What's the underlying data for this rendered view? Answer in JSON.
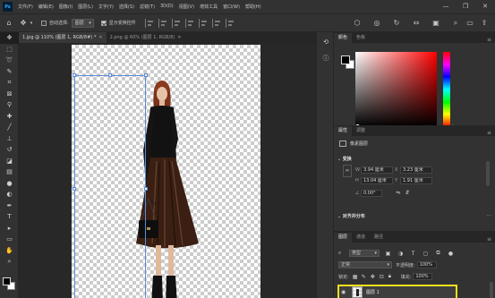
{
  "app": {
    "logo": "Ps"
  },
  "menu": [
    "文件(F)",
    "编辑(E)",
    "图像(I)",
    "图层(L)",
    "文字(Y)",
    "选择(S)",
    "滤镜(T)",
    "3D(D)",
    "视图(V)",
    "增效工具",
    "窗口(W)",
    "帮助(H)"
  ],
  "window_controls": {
    "minimize": "—",
    "restore": "❐",
    "close": "✕"
  },
  "options": {
    "auto_select_label": "自动选择:",
    "auto_select_target": "图层",
    "show_transform_label": "显示变换控件"
  },
  "tabs": [
    {
      "label": "1.jpg @ 110% (图层 1, RGB/8#) *",
      "active": true
    },
    {
      "label": "2.png @ 60% (图层 1, RGB/8)",
      "active": false
    }
  ],
  "tools": [
    "move-tool",
    "artboard-tool",
    "lasso-tool",
    "quick-select-tool",
    "crop-tool",
    "frame-tool",
    "eyedropper-tool",
    "healing-brush-tool",
    "brush-tool",
    "clone-stamp-tool",
    "history-brush-tool",
    "eraser-tool",
    "gradient-tool",
    "blur-tool",
    "dodge-tool",
    "pen-tool",
    "type-tool",
    "path-select-tool",
    "rectangle-tool",
    "hand-tool",
    "zoom-tool"
  ],
  "color_panel": {
    "tab_active": "颜色",
    "tab_other": "色板"
  },
  "properties_panel": {
    "tab_active": "属性",
    "tab_other": "调整",
    "layer_type": "像素图层",
    "transform_title": "变换",
    "w_label": "W",
    "w_value": "3.94 厘米",
    "x_label": "X",
    "x_value": "3.23 厘米",
    "h_label": "H",
    "h_value": "13.04 厘米",
    "y_label": "Y",
    "y_value": "1.91 厘米",
    "angle_label": "∠",
    "angle_value": "0.00°",
    "align_title": "对齐并分布"
  },
  "layers_panel": {
    "tabs": [
      "图层",
      "通道",
      "路径"
    ],
    "kind": "类型",
    "blend_mode": "正常",
    "opacity_label": "不透明度:",
    "opacity_value": "100%",
    "lock_label": "锁定:",
    "fill_label": "填充:",
    "fill_value": "100%",
    "layer_name": "图层 1"
  }
}
